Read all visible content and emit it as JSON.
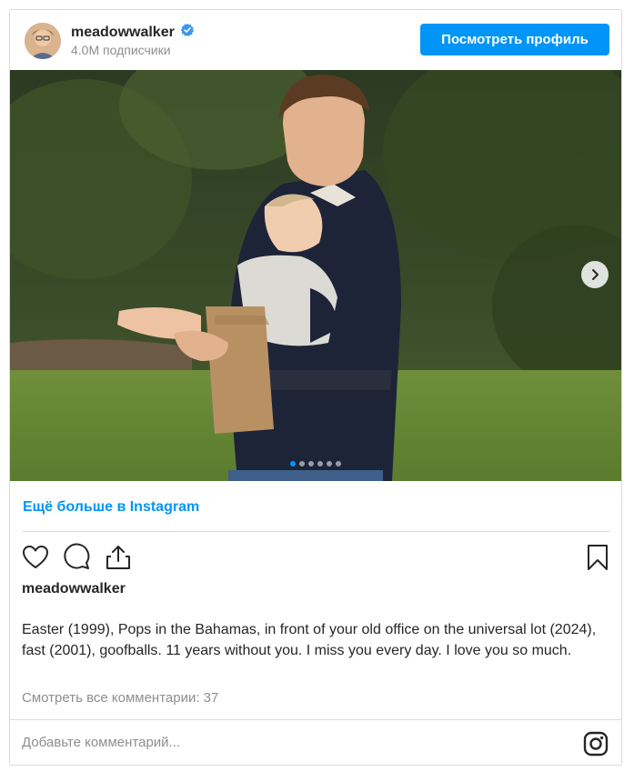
{
  "header": {
    "username": "meadowwalker",
    "followers": "4.0M подписчики",
    "view_profile_label": "Посмотреть профиль",
    "verified_color": "#3897f0"
  },
  "carousel": {
    "slide_count": 6,
    "active_index": 0,
    "next_icon": "chevron-right-icon"
  },
  "more_link": "Ещё больше в Instagram",
  "actions": {
    "icons": [
      "heart-icon",
      "comment-icon",
      "share-icon",
      "bookmark-icon"
    ]
  },
  "post": {
    "username": "meadowwalker",
    "caption": "Easter (1999), Pops in the Bahamas, in front of your old office on the universal lot (2024), fast (2001), goofballs. 11 years without you. I miss you every day. I love you so much.",
    "view_comments": "Смотреть все комментарии: 37"
  },
  "comment_box": {
    "placeholder": "Добавьте комментарий...",
    "icon": "instagram-icon"
  },
  "colors": {
    "accent": "#0095f6",
    "border": "#dbdbdb",
    "muted": "#8e8e8e",
    "text": "#262626"
  }
}
